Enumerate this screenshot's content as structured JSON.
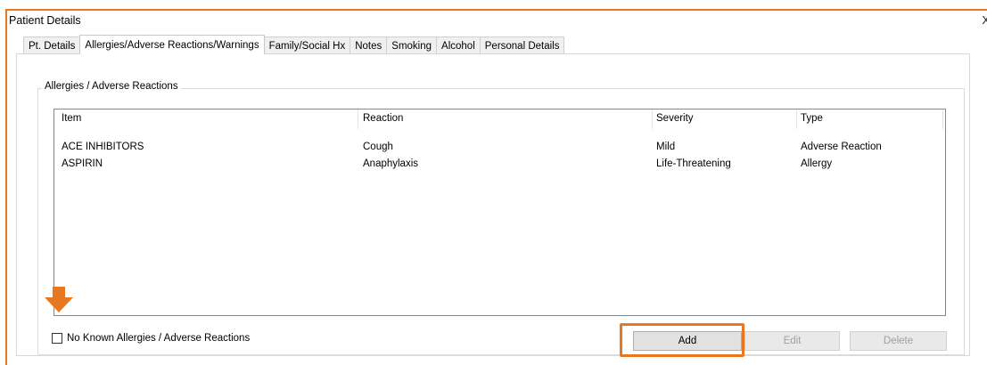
{
  "window": {
    "title": "Patient Details",
    "close_glyph": "X"
  },
  "tabs": [
    {
      "label": "Pt. Details"
    },
    {
      "label": "Allergies/Adverse Reactions/Warnings",
      "active": true
    },
    {
      "label": "Family/Social Hx"
    },
    {
      "label": "Notes"
    },
    {
      "label": "Smoking"
    },
    {
      "label": "Alcohol"
    },
    {
      "label": "Personal Details"
    }
  ],
  "group": {
    "legend": "Allergies / Adverse Reactions"
  },
  "table": {
    "columns": [
      "Item",
      "Reaction",
      "Severity",
      "Type"
    ],
    "rows": [
      [
        "ACE INHIBITORS",
        "Cough",
        "Mild",
        "Adverse Reaction"
      ],
      [
        "ASPIRIN",
        "Anaphylaxis",
        "Life-Threatening",
        "Allergy"
      ]
    ]
  },
  "nka": {
    "label": "No Known Allergies / Adverse Reactions",
    "checked": false
  },
  "buttons": {
    "add": "Add",
    "edit": "Edit",
    "delete": "Delete"
  },
  "annotation": {
    "color": "#e87722",
    "arrow_icon": "down-arrow-icon"
  }
}
